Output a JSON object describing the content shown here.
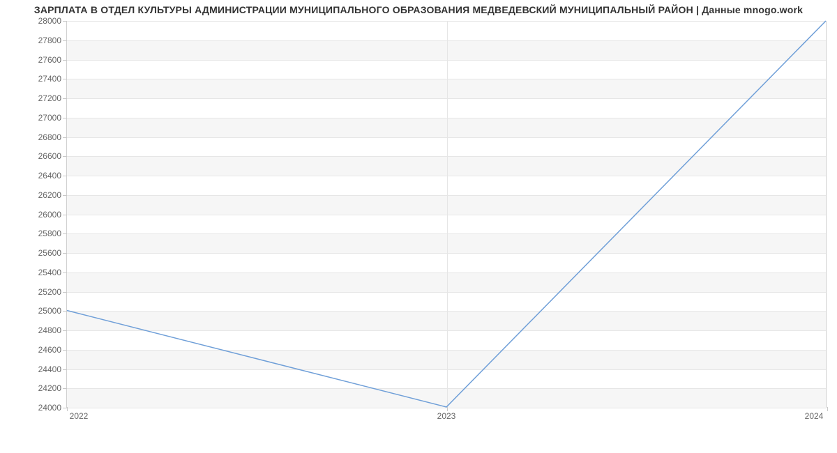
{
  "chart_data": {
    "type": "line",
    "title": "ЗАРПЛАТА В ОТДЕЛ КУЛЬТУРЫ АДМИНИСТРАЦИИ МУНИЦИПАЛЬНОГО ОБРАЗОВАНИЯ МЕДВЕДЕВСКИЙ МУНИЦИПАЛЬНЫЙ РАЙОН | Данные mnogo.work",
    "xlabel": "",
    "ylabel": "",
    "x": [
      "2022",
      "2023",
      "2024"
    ],
    "values": [
      25000,
      24000,
      28000
    ],
    "ylim": [
      24000,
      28000
    ],
    "y_ticks": [
      24000,
      24200,
      24400,
      24600,
      24800,
      25000,
      25200,
      25400,
      25600,
      25800,
      26000,
      26200,
      26400,
      26600,
      26800,
      27000,
      27200,
      27400,
      27600,
      27800,
      28000
    ],
    "line_color": "#6f9fd8"
  }
}
